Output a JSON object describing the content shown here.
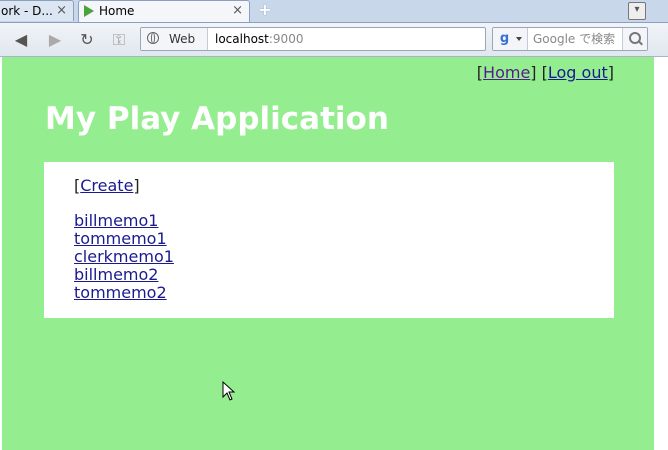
{
  "browser": {
    "tabs": [
      {
        "label": "ork - D..."
      },
      {
        "label": "Home"
      }
    ],
    "address": {
      "site_label": "Web",
      "host": "localhost",
      "port": ":9000"
    },
    "search": {
      "placeholder": "Google で検索"
    }
  },
  "page": {
    "nav": {
      "home": "Home",
      "logout": "Log out"
    },
    "title": "My Play Application",
    "create_label": "Create",
    "memos": [
      "billmemo1",
      "tommemo1",
      "clerkmemo1",
      "billmemo2",
      "tommemo2"
    ]
  },
  "colors": {
    "page_background": "#94ee90",
    "panel_background": "#ffffff",
    "title_color": "#ffffff"
  }
}
